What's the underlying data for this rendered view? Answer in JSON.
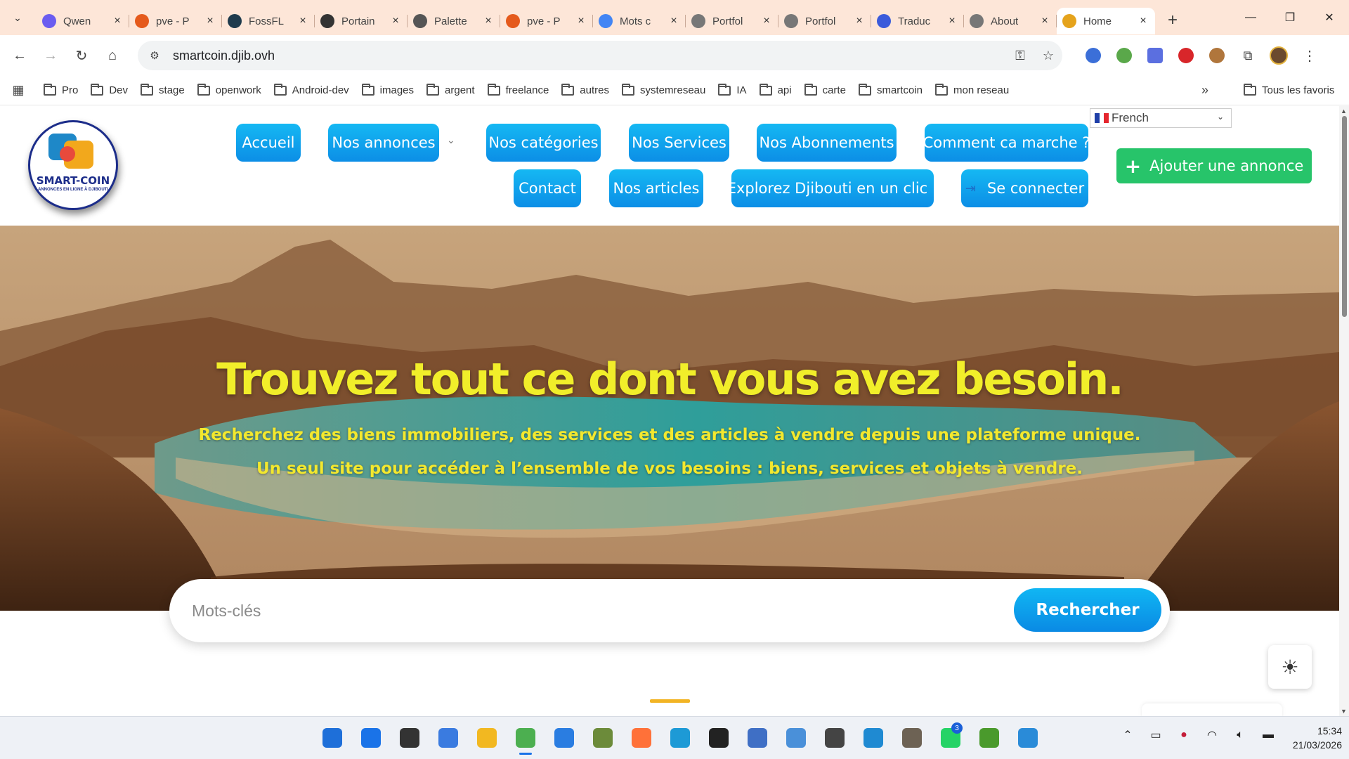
{
  "browser": {
    "tabs": [
      {
        "title": "Qwen",
        "color": "#6a5cf0"
      },
      {
        "title": "pve - P",
        "color": "#e55a1c"
      },
      {
        "title": "FossFL",
        "color": "#1f3b4d"
      },
      {
        "title": "Portain",
        "color": "#333333"
      },
      {
        "title": "Palette",
        "color": "#555555"
      },
      {
        "title": "pve - P",
        "color": "#e55a1c"
      },
      {
        "title": "Mots c",
        "color": "#4285f4"
      },
      {
        "title": "Portfol",
        "color": "#777777"
      },
      {
        "title": "Portfol",
        "color": "#777777"
      },
      {
        "title": "Traduc",
        "color": "#3b5bdb"
      },
      {
        "title": "About",
        "color": "#777777"
      },
      {
        "title": "Home",
        "color": "#e5a31c",
        "active": true
      }
    ],
    "url": "smartcoin.djib.ovh",
    "bookmarks": [
      "Pro",
      "Dev",
      "stage",
      "openwork",
      "Android-dev",
      "images",
      "argent",
      "freelance",
      "autres",
      "systemreseau",
      "IA",
      "api",
      "carte",
      "smartcoin",
      "mon reseau"
    ],
    "all_bookmarks": "Tous les favoris"
  },
  "site": {
    "logo": {
      "name": "SMART-COIN",
      "tagline": "ANNONCES EN LIGNE À DJIBOUTI"
    },
    "nav": {
      "accueil": "Accueil",
      "annonces": "Nos annonces",
      "categories": "Nos catégories",
      "services": "Nos Services",
      "abonnements": "Nos Abonnements",
      "comment": "Comment ca marche ?",
      "contact": "Contact",
      "articles": "Nos articles",
      "explorez": "Explorez Djibouti en un clic !",
      "connecter": "Se connecter"
    },
    "language": "French",
    "add_button": "Ajouter une annonce",
    "hero": {
      "title": "Trouvez tout ce dont vous avez besoin.",
      "subtitle1": "Recherchez des biens immobiliers, des services et des articles à vendre depuis une plateforme unique.",
      "subtitle2": "Un seul site pour accéder à l’ensemble de vos besoins : biens, services et objets à vendre."
    },
    "search": {
      "placeholder": "Mots-clés",
      "button": "Rechercher"
    },
    "colors": {
      "accent": "#0c9aee",
      "add": "#27c46a",
      "hero_text": "#f1ee2a"
    }
  },
  "taskbar": {
    "apps": [
      {
        "name": "windows-start",
        "color": "#1e6fd9"
      },
      {
        "name": "search",
        "color": "#1a73e8"
      },
      {
        "name": "task-view",
        "color": "#333333"
      },
      {
        "name": "app-store",
        "color": "#3a7be0"
      },
      {
        "name": "file-explorer",
        "color": "#f2b821"
      },
      {
        "name": "chrome",
        "color": "#4caf50",
        "active": true
      },
      {
        "name": "edge-blue",
        "color": "#2a7de1"
      },
      {
        "name": "paint",
        "color": "#6c8b3a"
      },
      {
        "name": "firefox",
        "color": "#ff7139"
      },
      {
        "name": "vmware",
        "color": "#1d9ad6"
      },
      {
        "name": "obs",
        "color": "#222222"
      },
      {
        "name": "network-tool",
        "color": "#3f6fc5"
      },
      {
        "name": "transfer-tool",
        "color": "#4a90d9"
      },
      {
        "name": "gpu-app",
        "color": "#444444"
      },
      {
        "name": "vscode",
        "color": "#1f8ad2"
      },
      {
        "name": "gimp",
        "color": "#6d6254"
      },
      {
        "name": "whatsapp",
        "color": "#25d366",
        "badge": "3"
      },
      {
        "name": "torrent",
        "color": "#4a9a2c"
      },
      {
        "name": "photo-app",
        "color": "#2a8bd8"
      }
    ],
    "time": "15:34",
    "date": "21/03/2026"
  }
}
